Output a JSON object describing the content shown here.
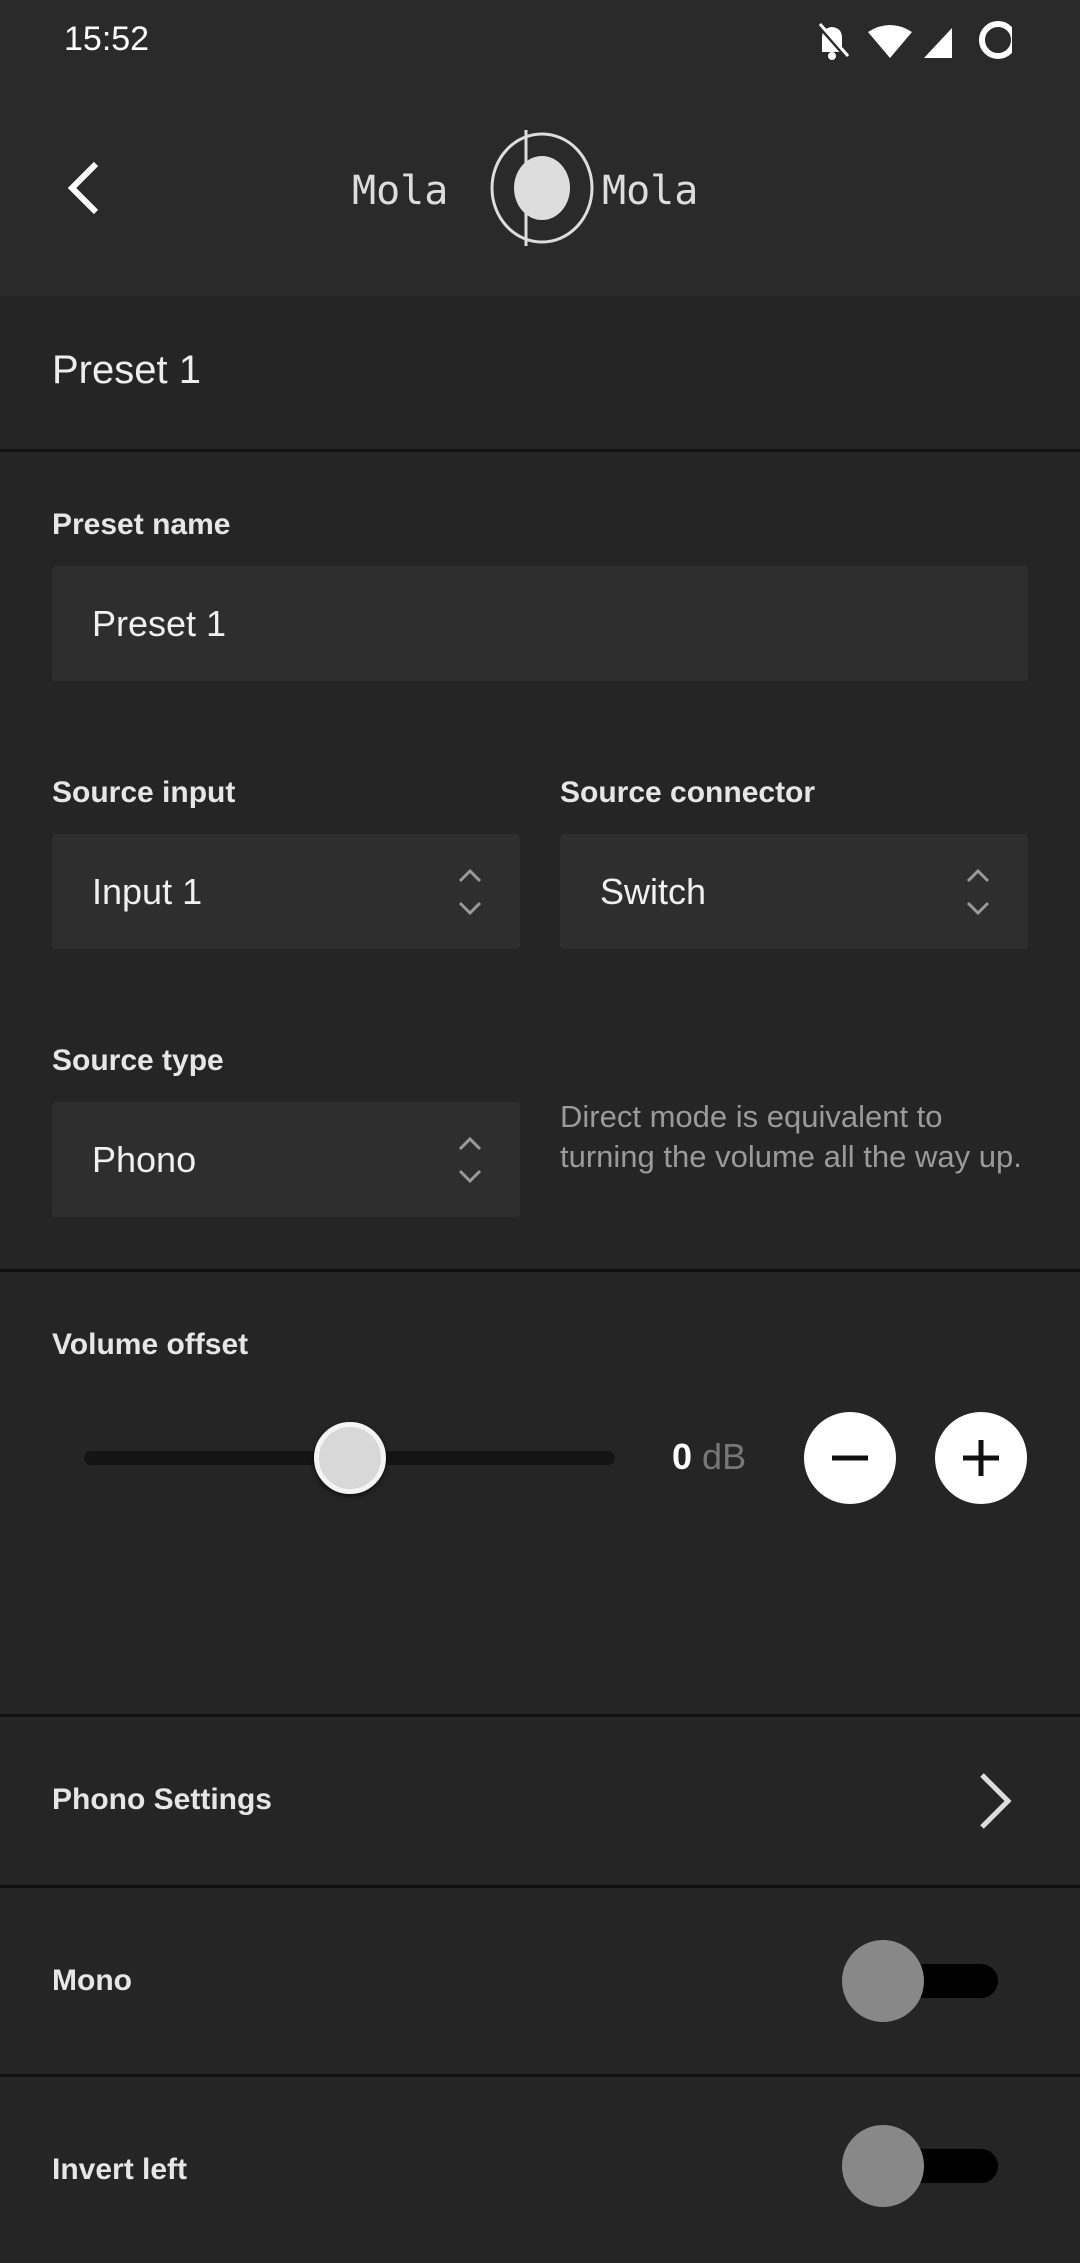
{
  "status_bar": {
    "time": "15:52",
    "icons": [
      "bell-off-icon",
      "wifi-icon",
      "signal-icon",
      "battery-ring-icon"
    ]
  },
  "header": {
    "brand": "Mola Mola",
    "back_icon": "chevron-left-icon"
  },
  "page_title": "Preset 1",
  "preset_name": {
    "label": "Preset name",
    "value": "Preset 1"
  },
  "source_input": {
    "label": "Source input",
    "value": "Input 1"
  },
  "source_connector": {
    "label": "Source connector",
    "value": "Switch"
  },
  "source_type": {
    "label": "Source type",
    "value": "Phono",
    "helper": "Direct mode is equivalent to turning the volume all the way up."
  },
  "volume_offset": {
    "label": "Volume offset",
    "value": "0",
    "unit": "dB",
    "slider_fraction": 0.5
  },
  "phono_settings": {
    "label": "Phono Settings"
  },
  "mono": {
    "label": "Mono",
    "on": false
  },
  "invert_left": {
    "label": "Invert left",
    "on": false
  }
}
